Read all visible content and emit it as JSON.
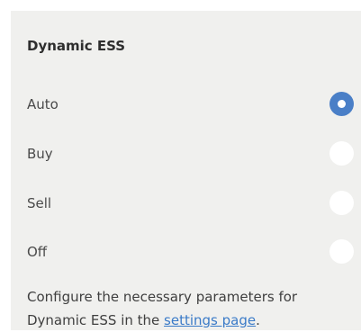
{
  "panel": {
    "title": "Dynamic ESS",
    "options": [
      {
        "label": "Auto",
        "selected": true
      },
      {
        "label": "Buy",
        "selected": false
      },
      {
        "label": "Sell",
        "selected": false
      },
      {
        "label": "Off",
        "selected": false
      }
    ],
    "note": {
      "line1": "Configure the necessary parameters for",
      "line2_prefix": "Dynamic ESS in the ",
      "link_text": "settings page",
      "line2_suffix": "."
    }
  },
  "colors": {
    "panel_bg": "#f0f0ee",
    "accent": "#4a7fc7",
    "link": "#3b7bc8"
  }
}
